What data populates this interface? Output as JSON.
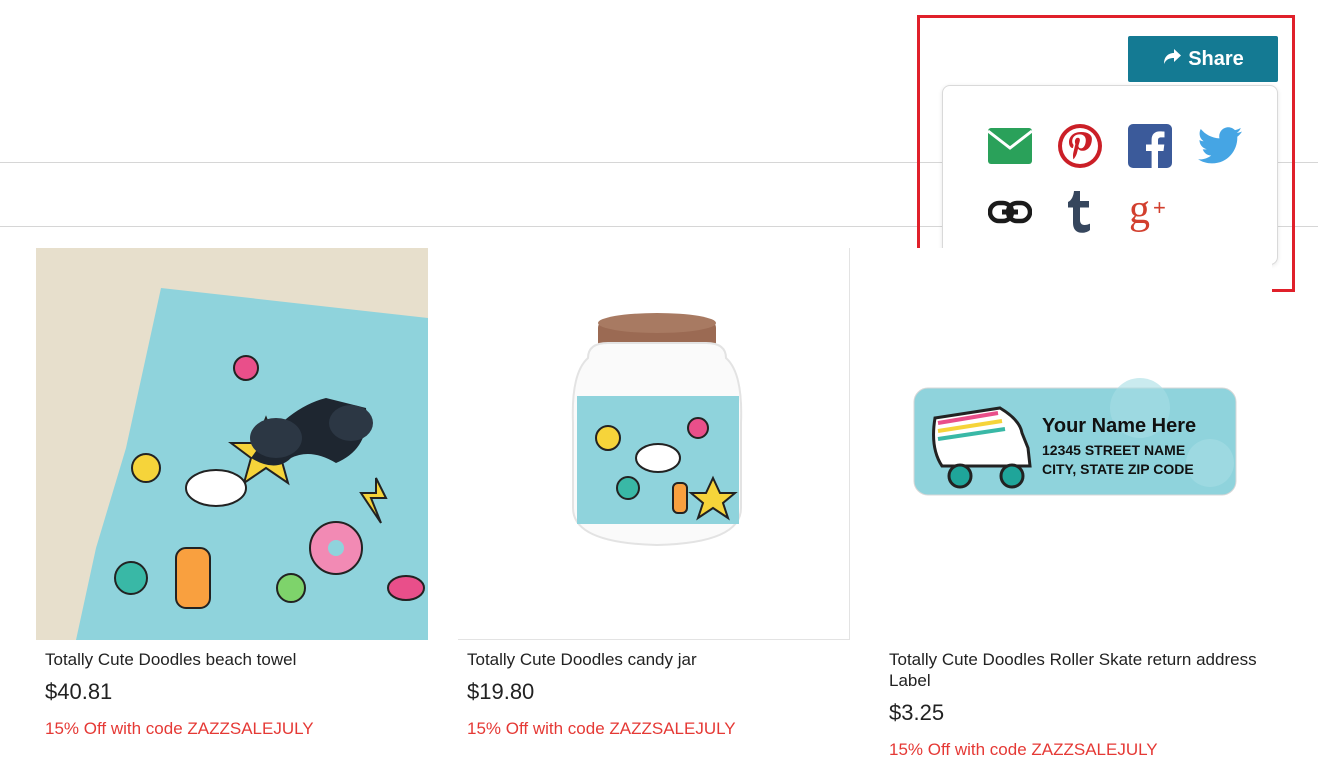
{
  "share": {
    "button_label": "Share",
    "icons": [
      "email-icon",
      "pinterest-icon",
      "facebook-icon",
      "twitter-icon",
      "link-icon",
      "tumblr-icon",
      "google-plus-icon"
    ],
    "highlight_color": "#e0202a",
    "button_color": "#147a93"
  },
  "products": [
    {
      "title": "Totally Cute Doodles beach towel",
      "price": "$40.81",
      "promo": "15% Off with code ZAZZSALEJULY"
    },
    {
      "title": "Totally Cute Doodles candy jar",
      "price": "$19.80",
      "promo": "15% Off with code ZAZZSALEJULY"
    },
    {
      "title": "Totally Cute Doodles Roller Skate return address Label",
      "price": "$3.25",
      "promo": "15% Off with code ZAZZSALEJULY"
    }
  ],
  "label_preview": {
    "name": "Your Name Here",
    "street": "12345 STREET NAME",
    "city": "CITY, STATE ZIP CODE"
  },
  "colors": {
    "promo": "#e53935",
    "doodle_bg": "#8fd3dc"
  }
}
